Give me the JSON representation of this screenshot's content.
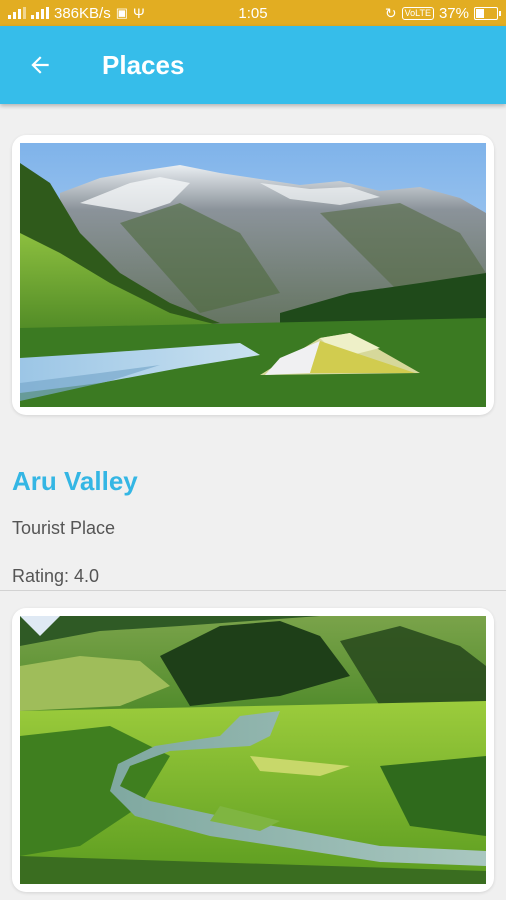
{
  "status_bar": {
    "network_speed": "386KB/s",
    "time": "1:05",
    "volte": "VoLTE",
    "battery_percent": "37%",
    "battery_level": 0.37
  },
  "app_bar": {
    "title": "Places",
    "back_icon": "arrow-left-icon"
  },
  "places": [
    {
      "name": "Aru Valley",
      "type": "Tourist Place",
      "rating": "Rating: 4.0"
    }
  ],
  "colors": {
    "status_bar": "#e2ad22",
    "app_bar": "#36bdea",
    "accent_title": "#34b6e4",
    "background": "#f0f0f0"
  }
}
